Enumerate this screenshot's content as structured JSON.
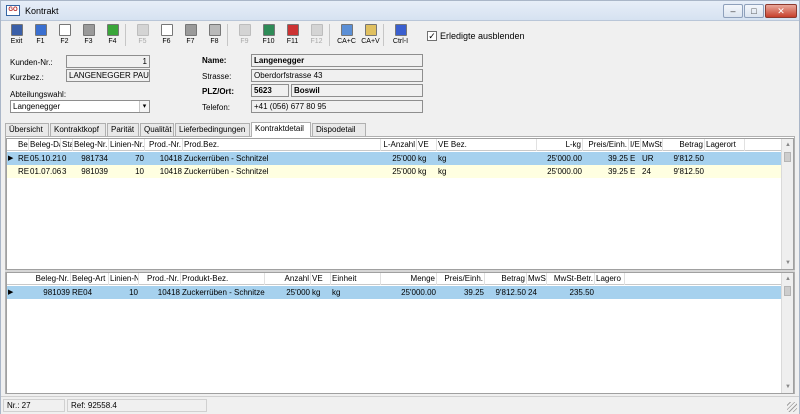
{
  "window": {
    "title": "Kontrakt",
    "app_icon_text": "GO"
  },
  "titlebar_buttons": {
    "minimize": "–",
    "maximize": "□",
    "close": "✕"
  },
  "toolbar": {
    "buttons": [
      {
        "label": "Exit",
        "icon": "exit-icon",
        "color": "#3a5fa8"
      },
      {
        "label": "F1",
        "icon": "help-icon",
        "color": "#3a6fd0"
      },
      {
        "label": "F2",
        "icon": "new-document-icon",
        "color": "#ffffff"
      },
      {
        "label": "F3",
        "icon": "delete-icon",
        "color": "#9a9a9a"
      },
      {
        "label": "F4",
        "icon": "green-arrow-icon",
        "color": "#3aa63a"
      },
      {
        "label": "F5",
        "icon": "disabled-icon",
        "color": "#cfcfcf"
      },
      {
        "label": "F6",
        "icon": "search-icon",
        "color": "#ffffff"
      },
      {
        "label": "F7",
        "icon": "edit-icon",
        "color": "#9a9a9a"
      },
      {
        "label": "F8",
        "icon": "print-icon",
        "color": "#b9b9b9"
      },
      {
        "label": "F9",
        "icon": "disabled-icon",
        "color": "#cfcfcf"
      },
      {
        "label": "F10",
        "icon": "calendar-icon",
        "color": "#2e8b57"
      },
      {
        "label": "F11",
        "icon": "refresh-icon",
        "color": "#cc3333"
      },
      {
        "label": "F12",
        "icon": "disabled-icon",
        "color": "#cfcfcf"
      },
      {
        "label": "CA+C",
        "icon": "copy-icon",
        "color": "#5b8fd6"
      },
      {
        "label": "CA+V",
        "icon": "paste-icon",
        "color": "#e0c060"
      },
      {
        "label": "Ctrl-I",
        "icon": "info-icon",
        "color": "#3a5fcf"
      }
    ],
    "checkbox_label": "Erledigte ausblenden",
    "checkbox_mark": "✓"
  },
  "header": {
    "kunden_nr_label": "Kunden-Nr.:",
    "kunden_nr_value": "1",
    "kurzbez_label": "Kurzbez.:",
    "kurzbez_value": "LANGENEGGER PAUL",
    "abteilung_label": "Abteilungswahl:",
    "abteilung_value": "Langenegger",
    "name_label": "Name:",
    "name_value": "Langenegger",
    "strasse_label": "Strasse:",
    "strasse_value": "Oberdorfstrasse 43",
    "plz_label": "PLZ/Ort:",
    "plz_value": "5623",
    "ort_value": "Boswil",
    "telefon_label": "Telefon:",
    "telefon_value": "+41 (056) 677 80 95"
  },
  "tabs": [
    "Übersicht",
    "Kontraktkopf",
    "Parität",
    "Qualität",
    "Lieferbedingungen",
    "Kontraktdetail",
    "Dispodetail"
  ],
  "active_tab": "Kontraktdetail",
  "grid1": {
    "headers": [
      "Beleg-",
      "Beleg-Datum",
      "Sta",
      "Beleg-Nr.",
      "Linien-Nr.",
      "Prod.-Nr.",
      "Prod.Bez.",
      "L-Anzahl",
      "VE",
      "VE Bez.",
      "L-kg",
      "Preis/Einh.",
      "I/E",
      "MwSt",
      "Betrag",
      "Lagerort"
    ],
    "rows": [
      [
        "RE09",
        "05.10.21",
        "0",
        "981734",
        "70",
        "10418",
        "Zuckerrüben - Schnitzel",
        "25'000",
        "kg",
        "kg",
        "25'000.00",
        "39.25",
        "E",
        "UR",
        "9'812.50",
        ""
      ],
      [
        "RE04",
        "01.07.06",
        "3",
        "981039",
        "10",
        "10418",
        "Zuckerrüben - Schnitzel",
        "25'000",
        "kg",
        "kg",
        "25'000.00",
        "39.25",
        "E",
        "24",
        "9'812.50",
        ""
      ]
    ]
  },
  "grid2": {
    "headers": [
      "Beleg-Nr.",
      "Beleg-Art",
      "Linien-Nr.",
      "Prod.-Nr.",
      "Produkt-Bez.",
      "Anzahl",
      "VE",
      "Einheit",
      "Menge",
      "Preis/Einh.",
      "Betrag",
      "MwSt",
      "MwSt-Betr.",
      "Lagero"
    ],
    "rows": [
      [
        "981039",
        "RE04",
        "10",
        "10418",
        "Zuckerrüben - Schnitzel",
        "25'000",
        "kg",
        "kg",
        "25'000.00",
        "39.25",
        "9'812.50",
        "24",
        "235.50",
        ""
      ]
    ]
  },
  "row_indicator": "▶",
  "scroll": {
    "up": "▲",
    "down": "▼"
  },
  "status": {
    "count": "Nr.: 27",
    "ref": "Ref: 92558.4"
  },
  "colors": {
    "selected_row": "#a6d1ee",
    "alt_row": "#ffffe1"
  }
}
